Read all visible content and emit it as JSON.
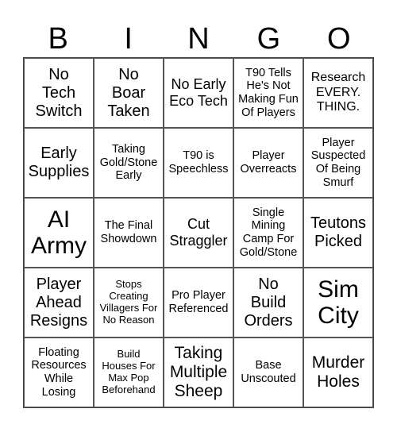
{
  "header": [
    "B",
    "I",
    "N",
    "G",
    "O"
  ],
  "cells": [
    "No\nTech\nSwitch",
    "No\nBoar\nTaken",
    "No Early\nEco Tech",
    "T90 Tells\nHe's Not\nMaking Fun\nOf Players",
    "Research\nEVERY.\nTHING.",
    "Early\nSupplies",
    "Taking\nGold/Stone\nEarly",
    "T90 is\nSpeechless",
    "Player\nOverreacts",
    "Player\nSuspected\nOf Being\nSmurf",
    "AI\nArmy",
    "The Final\nShowdown",
    "Cut\nStraggler",
    "Single\nMining\nCamp For\nGold/Stone",
    "Teutons\nPicked",
    "Player\nAhead\nResigns",
    "Stops\nCreating\nVillagers For\nNo Reason",
    "Pro Player\nReferenced",
    "No\nBuild\nOrders",
    "Sim\nCity",
    "Floating\nResources\nWhile\nLosing",
    "Build\nHouses For\nMax Pop\nBeforehand",
    "Taking\nMultiple\nSheep",
    "Base\nUnscouted",
    "Murder\nHoles"
  ]
}
